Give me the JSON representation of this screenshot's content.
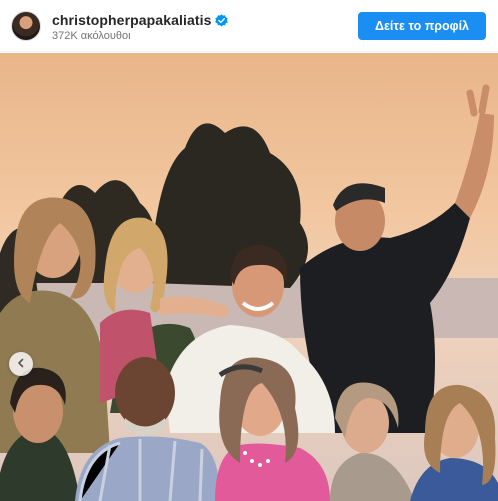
{
  "post": {
    "username": "christopherpapakaliatis",
    "followers": "372K ακόλουθοι",
    "profile_button_label": "Δείτε το προφίλ",
    "verified": true
  },
  "icons": {
    "verified": "verified-badge-icon",
    "prev": "chevron-left-icon"
  },
  "colors": {
    "accent": "#1a8ef2",
    "verified_badge": "#0095f6",
    "username": "#262626",
    "secondary_text": "#737373"
  }
}
